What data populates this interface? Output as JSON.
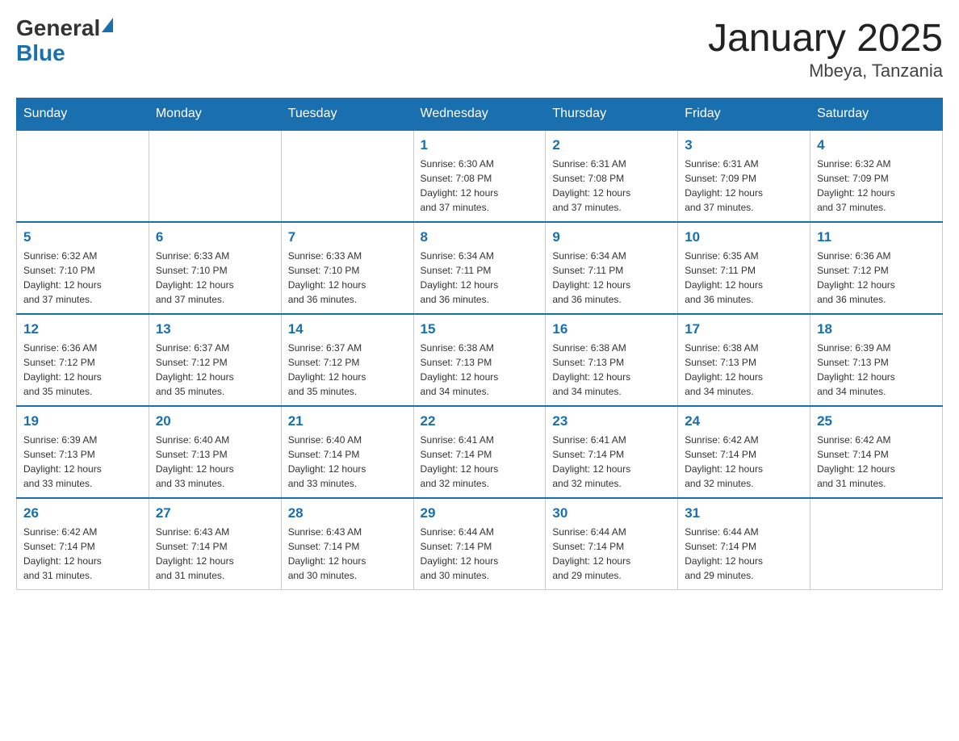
{
  "logo": {
    "general": "General",
    "blue": "Blue"
  },
  "title": "January 2025",
  "subtitle": "Mbeya, Tanzania",
  "days": [
    "Sunday",
    "Monday",
    "Tuesday",
    "Wednesday",
    "Thursday",
    "Friday",
    "Saturday"
  ],
  "weeks": [
    [
      {
        "day": "",
        "info": ""
      },
      {
        "day": "",
        "info": ""
      },
      {
        "day": "",
        "info": ""
      },
      {
        "day": "1",
        "info": "Sunrise: 6:30 AM\nSunset: 7:08 PM\nDaylight: 12 hours\nand 37 minutes."
      },
      {
        "day": "2",
        "info": "Sunrise: 6:31 AM\nSunset: 7:08 PM\nDaylight: 12 hours\nand 37 minutes."
      },
      {
        "day": "3",
        "info": "Sunrise: 6:31 AM\nSunset: 7:09 PM\nDaylight: 12 hours\nand 37 minutes."
      },
      {
        "day": "4",
        "info": "Sunrise: 6:32 AM\nSunset: 7:09 PM\nDaylight: 12 hours\nand 37 minutes."
      }
    ],
    [
      {
        "day": "5",
        "info": "Sunrise: 6:32 AM\nSunset: 7:10 PM\nDaylight: 12 hours\nand 37 minutes."
      },
      {
        "day": "6",
        "info": "Sunrise: 6:33 AM\nSunset: 7:10 PM\nDaylight: 12 hours\nand 37 minutes."
      },
      {
        "day": "7",
        "info": "Sunrise: 6:33 AM\nSunset: 7:10 PM\nDaylight: 12 hours\nand 36 minutes."
      },
      {
        "day": "8",
        "info": "Sunrise: 6:34 AM\nSunset: 7:11 PM\nDaylight: 12 hours\nand 36 minutes."
      },
      {
        "day": "9",
        "info": "Sunrise: 6:34 AM\nSunset: 7:11 PM\nDaylight: 12 hours\nand 36 minutes."
      },
      {
        "day": "10",
        "info": "Sunrise: 6:35 AM\nSunset: 7:11 PM\nDaylight: 12 hours\nand 36 minutes."
      },
      {
        "day": "11",
        "info": "Sunrise: 6:36 AM\nSunset: 7:12 PM\nDaylight: 12 hours\nand 36 minutes."
      }
    ],
    [
      {
        "day": "12",
        "info": "Sunrise: 6:36 AM\nSunset: 7:12 PM\nDaylight: 12 hours\nand 35 minutes."
      },
      {
        "day": "13",
        "info": "Sunrise: 6:37 AM\nSunset: 7:12 PM\nDaylight: 12 hours\nand 35 minutes."
      },
      {
        "day": "14",
        "info": "Sunrise: 6:37 AM\nSunset: 7:12 PM\nDaylight: 12 hours\nand 35 minutes."
      },
      {
        "day": "15",
        "info": "Sunrise: 6:38 AM\nSunset: 7:13 PM\nDaylight: 12 hours\nand 34 minutes."
      },
      {
        "day": "16",
        "info": "Sunrise: 6:38 AM\nSunset: 7:13 PM\nDaylight: 12 hours\nand 34 minutes."
      },
      {
        "day": "17",
        "info": "Sunrise: 6:38 AM\nSunset: 7:13 PM\nDaylight: 12 hours\nand 34 minutes."
      },
      {
        "day": "18",
        "info": "Sunrise: 6:39 AM\nSunset: 7:13 PM\nDaylight: 12 hours\nand 34 minutes."
      }
    ],
    [
      {
        "day": "19",
        "info": "Sunrise: 6:39 AM\nSunset: 7:13 PM\nDaylight: 12 hours\nand 33 minutes."
      },
      {
        "day": "20",
        "info": "Sunrise: 6:40 AM\nSunset: 7:13 PM\nDaylight: 12 hours\nand 33 minutes."
      },
      {
        "day": "21",
        "info": "Sunrise: 6:40 AM\nSunset: 7:14 PM\nDaylight: 12 hours\nand 33 minutes."
      },
      {
        "day": "22",
        "info": "Sunrise: 6:41 AM\nSunset: 7:14 PM\nDaylight: 12 hours\nand 32 minutes."
      },
      {
        "day": "23",
        "info": "Sunrise: 6:41 AM\nSunset: 7:14 PM\nDaylight: 12 hours\nand 32 minutes."
      },
      {
        "day": "24",
        "info": "Sunrise: 6:42 AM\nSunset: 7:14 PM\nDaylight: 12 hours\nand 32 minutes."
      },
      {
        "day": "25",
        "info": "Sunrise: 6:42 AM\nSunset: 7:14 PM\nDaylight: 12 hours\nand 31 minutes."
      }
    ],
    [
      {
        "day": "26",
        "info": "Sunrise: 6:42 AM\nSunset: 7:14 PM\nDaylight: 12 hours\nand 31 minutes."
      },
      {
        "day": "27",
        "info": "Sunrise: 6:43 AM\nSunset: 7:14 PM\nDaylight: 12 hours\nand 31 minutes."
      },
      {
        "day": "28",
        "info": "Sunrise: 6:43 AM\nSunset: 7:14 PM\nDaylight: 12 hours\nand 30 minutes."
      },
      {
        "day": "29",
        "info": "Sunrise: 6:44 AM\nSunset: 7:14 PM\nDaylight: 12 hours\nand 30 minutes."
      },
      {
        "day": "30",
        "info": "Sunrise: 6:44 AM\nSunset: 7:14 PM\nDaylight: 12 hours\nand 29 minutes."
      },
      {
        "day": "31",
        "info": "Sunrise: 6:44 AM\nSunset: 7:14 PM\nDaylight: 12 hours\nand 29 minutes."
      },
      {
        "day": "",
        "info": ""
      }
    ]
  ]
}
